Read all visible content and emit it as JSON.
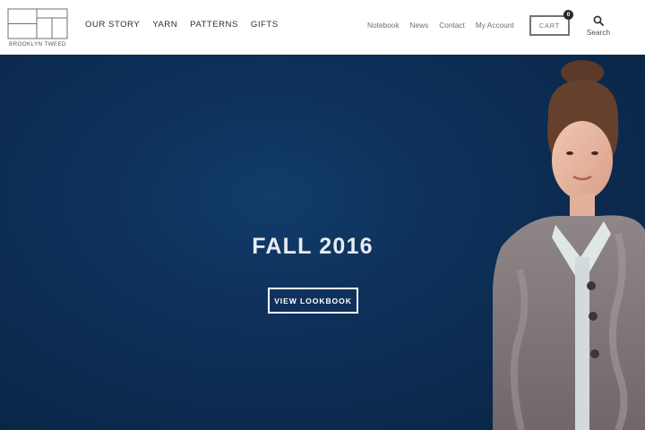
{
  "brand": {
    "name": "BROOKLYN TWEED"
  },
  "main_nav": [
    {
      "label": "OUR STORY"
    },
    {
      "label": "YARN"
    },
    {
      "label": "PATTERNS"
    },
    {
      "label": "GIFTS"
    }
  ],
  "util_nav": [
    {
      "label": "Notebook"
    },
    {
      "label": "News"
    },
    {
      "label": "Contact"
    },
    {
      "label": "My Account"
    }
  ],
  "cart": {
    "label": "CART",
    "count": "0"
  },
  "search": {
    "label": "Search",
    "icon": "magnifier-icon"
  },
  "hero": {
    "title": "FALL 2016",
    "button_label": "VIEW LOOKBOOK",
    "background_color": "#0d2f58"
  },
  "colors": {
    "nav_text": "#2d2f33",
    "util_text": "#6b7077",
    "hero_text": "#ffffff"
  }
}
